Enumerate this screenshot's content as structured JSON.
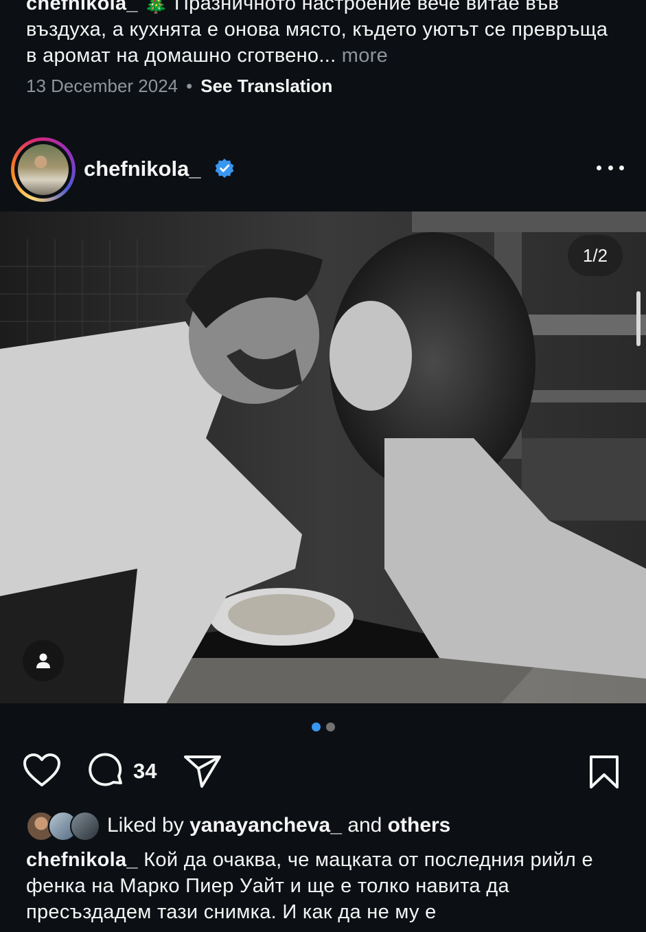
{
  "previous_post": {
    "username": "chefnikola_",
    "emoji": "🎄",
    "caption_text": "Празничното настроение вече витае във въздуха, а кухнята е онова място, където уютът се превръща в аромат на домашно сготвено...",
    "more_label": "more",
    "date": "13 December 2024",
    "separator": "•",
    "translation_label": "See Translation"
  },
  "post": {
    "username": "chefnikola_",
    "verified": true,
    "more_icon": "ellipsis-icon",
    "image_counter": "1/2",
    "carousel": {
      "total": 2,
      "active": 0
    },
    "comment_count": "34",
    "liked_by_prefix": "Liked by",
    "liked_by_user": "yanayancheva_",
    "liked_by_and": "and",
    "liked_by_others": "others",
    "caption_user": "chefnikola_",
    "caption_text": "Кой да очаква, че мацката от последния рийл е фенка на Марко Пиер Уайт и ще е толко навита да пресъздадем тази снимка. И как да не му е"
  },
  "colors": {
    "background": "#0c1014",
    "text": "#f5f5f5",
    "secondary_text": "#8e959c",
    "verified_blue": "#3897f0",
    "active_dot": "#3897f0",
    "inactive_dot": "#737373"
  }
}
